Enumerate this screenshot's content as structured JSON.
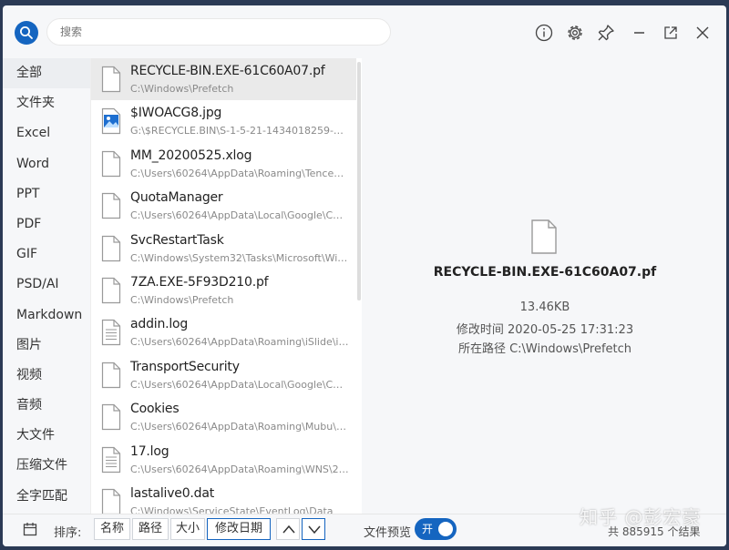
{
  "search": {
    "placeholder": "搜索"
  },
  "toolbar": {
    "icons": [
      "info-icon",
      "settings-icon",
      "pin-icon",
      "minimize-icon",
      "open-external-icon",
      "close-icon"
    ]
  },
  "sidebar": {
    "items": [
      {
        "label": "全部",
        "active": true
      },
      {
        "label": "文件夹"
      },
      {
        "label": "Excel"
      },
      {
        "label": "Word"
      },
      {
        "label": "PPT"
      },
      {
        "label": "PDF"
      },
      {
        "label": "GIF"
      },
      {
        "label": "PSD/AI"
      },
      {
        "label": "Markdown"
      },
      {
        "label": "图片"
      },
      {
        "label": "视频"
      },
      {
        "label": "音频"
      },
      {
        "label": "大文件"
      },
      {
        "label": "压缩文件"
      },
      {
        "label": "全字匹配"
      }
    ]
  },
  "files": [
    {
      "name": "RECYCLE-BIN.EXE-61C60A07.pf",
      "path": "C:\\Windows\\Prefetch",
      "icon": "file-icon",
      "selected": true
    },
    {
      "name": "$IWOACG8.jpg",
      "path": "G:\\$RECYCLE.BIN\\S-1-5-21-1434018259-206...",
      "icon": "image-file-icon"
    },
    {
      "name": "MM_20200525.xlog",
      "path": "C:\\Users\\60264\\AppData\\Roaming\\Tencent\\...",
      "icon": "file-icon"
    },
    {
      "name": "QuotaManager",
      "path": "C:\\Users\\60264\\AppData\\Local\\Google\\Chro...",
      "icon": "file-icon"
    },
    {
      "name": "SvcRestartTask",
      "path": "C:\\Windows\\System32\\Tasks\\Microsoft\\Wind...",
      "icon": "file-icon"
    },
    {
      "name": "7ZA.EXE-5F93D210.pf",
      "path": "C:\\Windows\\Prefetch",
      "icon": "file-icon"
    },
    {
      "name": "addin.log",
      "path": "C:\\Users\\60264\\AppData\\Roaming\\iSlide\\iSli...",
      "icon": "text-file-icon"
    },
    {
      "name": "TransportSecurity",
      "path": "C:\\Users\\60264\\AppData\\Local\\Google\\Chro...",
      "icon": "file-icon"
    },
    {
      "name": "Cookies",
      "path": "C:\\Users\\60264\\AppData\\Roaming\\Mubu\\m...",
      "icon": "file-icon"
    },
    {
      "name": "17.log",
      "path": "C:\\Users\\60264\\AppData\\Roaming\\WNS\\201...",
      "icon": "text-file-icon"
    },
    {
      "name": "lastalive0.dat",
      "path": "C:\\Windows\\ServiceState\\EventLog\\Data",
      "icon": "file-icon"
    }
  ],
  "preview": {
    "name": "RECYCLE-BIN.EXE-61C60A07.pf",
    "size": "13.46KB",
    "modified": "修改时间 2020-05-25 17:31:23",
    "path": "所在路径 C:\\Windows\\Prefetch"
  },
  "bottombar": {
    "sort_label": "排序:",
    "sort_options": [
      "名称",
      "路径",
      "大小",
      "修改日期"
    ],
    "active_sort": "修改日期",
    "order": "descending",
    "preview_label": "文件预览",
    "preview_toggle": "开",
    "count": "共 885915 个结果"
  },
  "watermark": "知乎 @彭宏豪",
  "colors": {
    "accent": "#1565c0",
    "selected_row": "#eaeaea"
  }
}
